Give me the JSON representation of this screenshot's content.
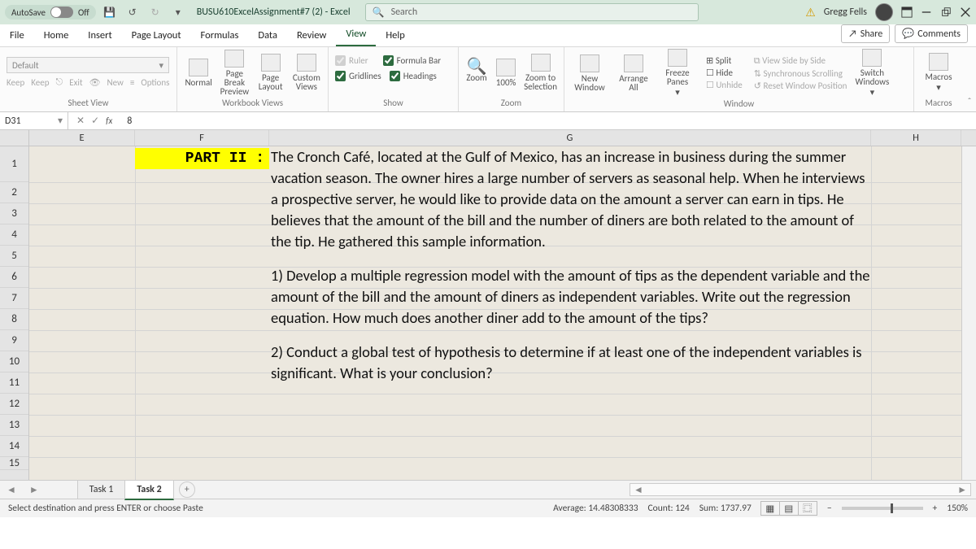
{
  "titlebar": {
    "autosave_label": "AutoSave",
    "autosave_state": "Off",
    "doc_title": "BUSU610ExcelAssignment#7 (2) - Excel",
    "search_placeholder": "Search",
    "username": "Gregg Fells"
  },
  "menu": {
    "tabs": [
      "File",
      "Home",
      "Insert",
      "Page Layout",
      "Formulas",
      "Data",
      "Review",
      "View",
      "Help"
    ],
    "active": "View",
    "share": "Share",
    "comments": "Comments"
  },
  "ribbon": {
    "sheet_view": {
      "default": "Default",
      "keep": "Keep",
      "exit": "Exit",
      "new": "New",
      "options": "Options",
      "label": "Sheet View"
    },
    "workbook_views": {
      "normal": "Normal",
      "page_break": "Page Break Preview",
      "page_layout": "Page Layout",
      "custom": "Custom Views",
      "label": "Workbook Views"
    },
    "show": {
      "ruler": "Ruler",
      "formula_bar": "Formula Bar",
      "gridlines": "Gridlines",
      "headings": "Headings",
      "label": "Show"
    },
    "zoom": {
      "zoom": "Zoom",
      "hundred": "100%",
      "selection": "Zoom to Selection",
      "label": "Zoom"
    },
    "window": {
      "new": "New Window",
      "arrange": "Arrange All",
      "freeze": "Freeze Panes",
      "split": "Split",
      "hide": "Hide",
      "unhide": "Unhide",
      "side": "View Side by Side",
      "sync": "Synchronous Scrolling",
      "reset": "Reset Window Position",
      "switch": "Switch Windows",
      "label": "Window"
    },
    "macros": {
      "macros": "Macros",
      "label": "Macros"
    }
  },
  "formula_bar": {
    "cell_ref": "D31",
    "value": "8"
  },
  "columns": {
    "E": "E",
    "F": "F",
    "G": "G",
    "H": "H"
  },
  "part2_label": "PART II :",
  "instructions": {
    "intro": "The Cronch Café, located at the Gulf of Mexico, has an increase in business during the summer vacation season. The owner hires a large number of servers as seasonal help. When he interviews a prospective server, he would like to provide data on the amount a server can earn in tips. He believes that the amount of the bill and the number of diners are both related to the amount of the tip. He gathered this sample information.",
    "q1": "1) Develop a multiple regression model with the amount of tips as the dependent variable and the amount of the bill and the amount of diners as independent variables. Write out the regression equation. How much does another diner add to the amount of the tips?",
    "q2": "2) Conduct a global test of hypothesis to determine if at least one of the independent variables is significant. What is your conclusion?"
  },
  "sheet_tabs": {
    "task1": "Task 1",
    "task2": "Task 2"
  },
  "statusbar": {
    "msg": "Select destination and press ENTER or choose Paste",
    "average": "Average: 14.48308333",
    "count": "Count: 124",
    "sum": "Sum: 1737.97",
    "zoom": "150%"
  }
}
